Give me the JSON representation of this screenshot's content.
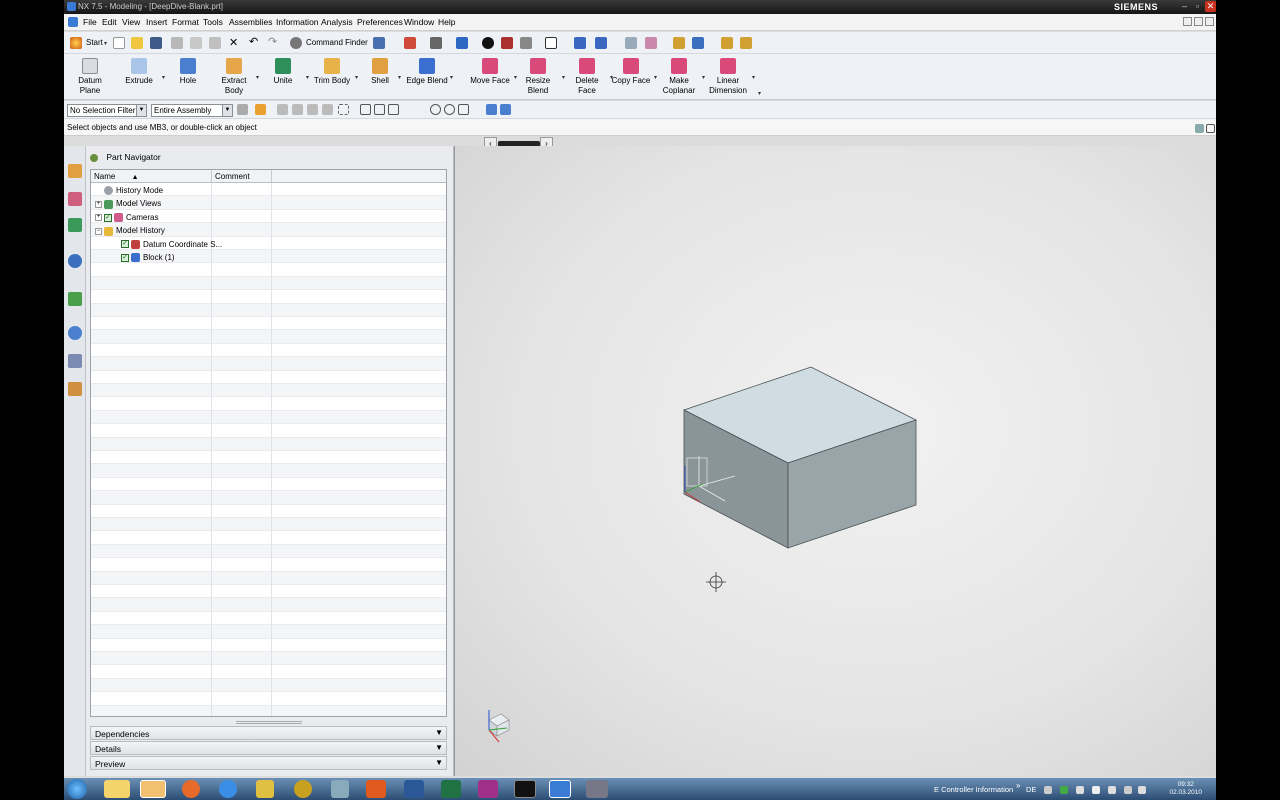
{
  "window": {
    "title": "NX 7.5 - Modeling - [DeepDive-Blank.prt]",
    "brand": "SIEMENS"
  },
  "menu": [
    "File",
    "Edit",
    "View",
    "Insert",
    "Format",
    "Tools",
    "Assemblies",
    "Information",
    "Analysis",
    "Preferences",
    "Window",
    "Help"
  ],
  "standard_toolbar": {
    "start_label": "Start",
    "command_finder_label": "Command Finder"
  },
  "feature_toolbar": [
    {
      "label": "Datum Plane",
      "icon": "datum-plane-icon",
      "color": "#d9dde3"
    },
    {
      "label": "Extrude",
      "icon": "extrude-icon",
      "color": "#a9c6e8"
    },
    {
      "label": "Hole",
      "icon": "hole-icon",
      "color": "#4a7fd0"
    },
    {
      "label": "Extract Body",
      "icon": "extract-body-icon",
      "color": "#e8a64a"
    },
    {
      "label": "Unite",
      "icon": "unite-icon",
      "color": "#2f8f5a"
    },
    {
      "label": "Trim Body",
      "icon": "trim-body-icon",
      "color": "#e8b24a"
    },
    {
      "label": "Shell",
      "icon": "shell-icon",
      "color": "#e0a040"
    },
    {
      "label": "Edge Blend",
      "icon": "edge-blend-icon",
      "color": "#3b6fd0"
    },
    {
      "label": "Move Face",
      "icon": "move-face-icon",
      "color": "#d94a7a"
    },
    {
      "label": "Resize Blend",
      "icon": "resize-blend-icon",
      "color": "#d94a7a"
    },
    {
      "label": "Delete Face",
      "icon": "delete-face-icon",
      "color": "#d94a7a"
    },
    {
      "label": "Copy Face",
      "icon": "copy-face-icon",
      "color": "#d94a7a"
    },
    {
      "label": "Make Coplanar",
      "icon": "make-coplanar-icon",
      "color": "#d94a7a"
    },
    {
      "label": "Linear Dimension",
      "icon": "linear-dimension-icon",
      "color": "#d94a7a"
    }
  ],
  "selection_bar": {
    "filter": "No Selection Filter",
    "scope": "Entire Assembly"
  },
  "cue_line": "Select objects and use MB3, or double-click an object",
  "part_navigator": {
    "title": "Part Navigator",
    "columns": [
      "Name",
      "Comment"
    ],
    "tree": [
      {
        "label": "History Mode",
        "level": 0,
        "expander": "",
        "icon": "clock-icon",
        "check": false
      },
      {
        "label": "Model Views",
        "level": 0,
        "expander": "+",
        "icon": "model-views-icon",
        "check": false
      },
      {
        "label": "Cameras",
        "level": 0,
        "expander": "+",
        "icon": "cameras-icon",
        "check": true
      },
      {
        "label": "Model History",
        "level": 0,
        "expander": "−",
        "icon": "folder-icon",
        "check": false
      },
      {
        "label": "Datum Coordinate S...",
        "level": 1,
        "expander": "",
        "icon": "datum-csys-icon",
        "check": true
      },
      {
        "label": "Block (1)",
        "level": 1,
        "expander": "",
        "icon": "block-icon",
        "check": true
      }
    ],
    "panels": [
      "Dependencies",
      "Details",
      "Preview"
    ]
  },
  "taskbar": {
    "tray_text": "E Controller Information",
    "lang": "DE",
    "time": "09:32",
    "date": "02.03.2010"
  },
  "colors": {
    "block_top": "#cfdde3",
    "block_front": "#8a9599",
    "block_side": "#9aa5a9"
  }
}
